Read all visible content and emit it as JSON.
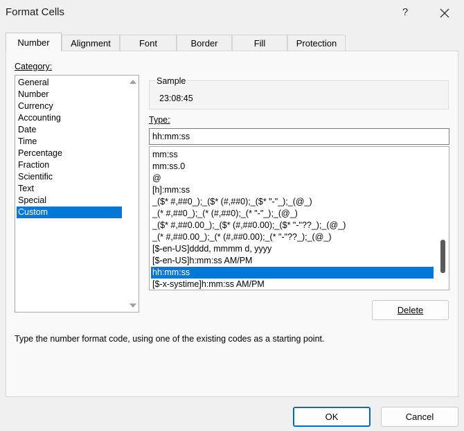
{
  "window": {
    "title": "Format Cells",
    "help_label": "?",
    "close_icon": "close-icon"
  },
  "tabs": [
    {
      "label": "Number",
      "active": true
    },
    {
      "label": "Alignment",
      "active": false
    },
    {
      "label": "Font",
      "active": false
    },
    {
      "label": "Border",
      "active": false
    },
    {
      "label": "Fill",
      "active": false
    },
    {
      "label": "Protection",
      "active": false
    }
  ],
  "category": {
    "label": "Category:",
    "items": [
      "General",
      "Number",
      "Currency",
      "Accounting",
      "Date",
      "Time",
      "Percentage",
      "Fraction",
      "Scientific",
      "Text",
      "Special",
      "Custom"
    ],
    "selected": "Custom"
  },
  "sample": {
    "label": "Sample",
    "value": "23:08:45"
  },
  "type": {
    "label": "Type:",
    "value": "hh:mm:ss",
    "items": [
      "mm:ss",
      "mm:ss.0",
      "@",
      "[h]:mm:ss",
      "_($* #,##0_);_($* (#,##0);_($* \"-\"_);_(@_)",
      "_(* #,##0_);_(* (#,##0);_(* \"-\"_);_(@_)",
      "_($* #,##0.00_);_($* (#,##0.00);_($* \"-\"??_);_(@_)",
      "_(* #,##0.00_);_(* (#,##0.00);_(* \"-\"??_);_(@_)",
      "[$-en-US]dddd, mmmm d, yyyy",
      "[$-en-US]h:mm:ss AM/PM",
      "hh:mm:ss",
      "[$-x-systime]h:mm:ss AM/PM"
    ],
    "selected": "hh:mm:ss"
  },
  "buttons": {
    "delete": "Delete",
    "ok": "OK",
    "cancel": "Cancel"
  },
  "help_text": "Type the number format code, using one of the existing codes as a starting point.",
  "colors": {
    "selection": "#0078d7",
    "dialog_bg": "#f0f0f0",
    "panel_bg": "#f9f9f9"
  }
}
